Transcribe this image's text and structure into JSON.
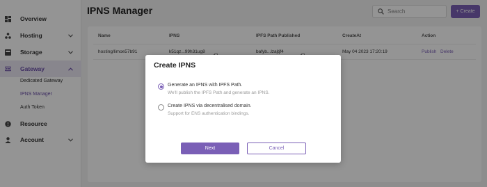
{
  "sidebar": {
    "items": [
      {
        "label": "Overview",
        "icon": "dashboard-icon"
      },
      {
        "label": "Hosting",
        "icon": "hosting-icon",
        "expandable": true
      },
      {
        "label": "Storage",
        "icon": "storage-icon",
        "expandable": true
      },
      {
        "label": "Gateway",
        "icon": "gateway-icon",
        "expandable": true,
        "expanded": true
      },
      {
        "label": "Resource",
        "icon": "resource-icon"
      },
      {
        "label": "Account",
        "icon": "account-icon",
        "expandable": true
      }
    ],
    "gateway_subitems": [
      {
        "label": "Dedicated Gateway"
      },
      {
        "label": "IPNS Manager",
        "active": true
      },
      {
        "label": "Auth Token"
      }
    ]
  },
  "header": {
    "title": "IPNS Manager",
    "search_placeholder": "Search",
    "create_label": "+ Create"
  },
  "table": {
    "columns": [
      "Name",
      "IPNS",
      "IPFS Path Published",
      "CreateAt",
      "Action"
    ],
    "rows": [
      {
        "name": "hosting/limoe57b91",
        "ipns": "k51qz...99h31ug8",
        "ipfs_path": "bafyb...lzajtjf4",
        "created_at": "May 04 2023 17:20:19",
        "actions": [
          "Publish",
          "Delete"
        ]
      }
    ]
  },
  "modal": {
    "title": "Create IPNS",
    "options": [
      {
        "label": "Generate an IPNS with IPFS Path.",
        "description": "We'll publish the IPFS Path and generate an IPNS.",
        "checked": true
      },
      {
        "label": "Create IPNS via decentralised domain.",
        "description": "Support for ENS authentication bindings.",
        "checked": false
      }
    ],
    "next_label": "Next",
    "cancel_label": "Cancel"
  },
  "colors": {
    "accent": "#7a5fb6",
    "active_bg": "#ebe7f3",
    "overlay": "rgba(0,0,0,0.42)"
  }
}
